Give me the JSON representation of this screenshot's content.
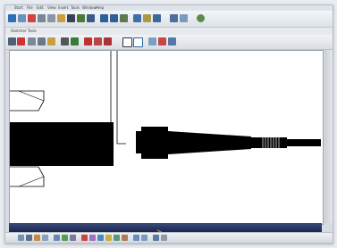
{
  "window": {
    "menu_items": [
      "Start",
      "File",
      "Edit",
      "View",
      "Insert",
      "Tools",
      "Window",
      "Help"
    ],
    "sub_toolbar_label": "Sketcher Tools"
  },
  "colors": {
    "canvas_bg": "#ffffff",
    "geometry": "#000000",
    "status_bar": "#1c2750",
    "toolbar_bg": "#dde2e8"
  },
  "icons": {
    "top_toolbar": [
      "cursor-icon",
      "new-icon",
      "cut-icon",
      "copy-icon",
      "paste-icon",
      "undo-icon",
      "redo-icon",
      "measure-icon",
      "grid-icon",
      "snap-icon",
      "constraint-icon",
      "help-icon",
      "zoom-icon",
      "pan-icon",
      "rotate-icon",
      "fit-icon",
      "view-icon"
    ],
    "sketch_toolbar": [
      "select-icon",
      "line-icon",
      "circle-icon",
      "arc-icon",
      "spline-icon",
      "rectangle-icon",
      "point-icon",
      "axis-icon",
      "corner-icon",
      "chamfer-icon",
      "trim-icon",
      "mirror-icon",
      "offset-icon",
      "project-icon",
      "dimension-icon"
    ],
    "bottom_toolbar": [
      "plane-icon",
      "profile-icon",
      "sketch-icon",
      "exit-icon",
      "pad-icon",
      "pocket-icon",
      "shaft-icon",
      "groove-icon",
      "hole-icon",
      "rib-icon",
      "slot-icon",
      "fillet-icon",
      "chamfer-icon",
      "draft-icon",
      "shell-icon",
      "thread-icon",
      "measure-icon"
    ]
  }
}
